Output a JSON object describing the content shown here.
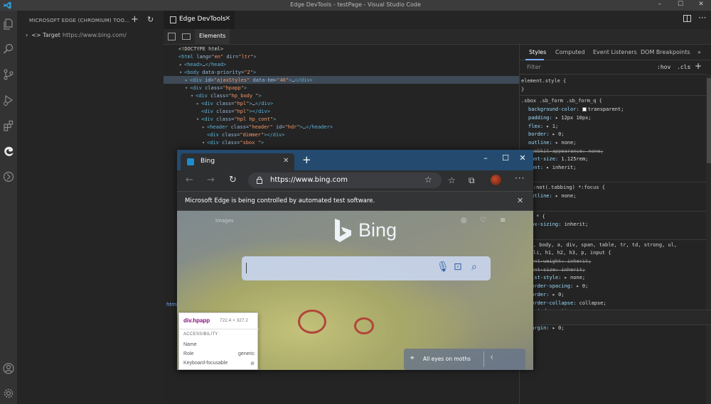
{
  "window": {
    "title": "Edge DevTools - testPage - Visual Studio Code"
  },
  "activity_bar": {
    "icons": [
      "explorer-icon",
      "search-icon",
      "source-control-icon",
      "run-debug-icon",
      "extensions-icon",
      "edge-devtools-icon",
      "remote-explorer-icon",
      "account-icon",
      "settings-gear-icon"
    ]
  },
  "sidebar": {
    "header": "MICROSOFT EDGE (CHROMIUM) TOO...",
    "target_label": "Target",
    "target_url": "https://www.bing.com/"
  },
  "editor": {
    "tab_label": "Edge DevTools"
  },
  "devtools": {
    "panel_tab": "Elements",
    "dom": [
      {
        "indent": 0,
        "tri": "",
        "parts": [
          [
            "txt",
            "<!DOCTYPE html>"
          ]
        ]
      },
      {
        "indent": 0,
        "tri": "",
        "parts": [
          [
            "tag",
            "<html "
          ],
          [
            "attr",
            "lang="
          ],
          [
            "val",
            "\"en\""
          ],
          [
            "attr",
            " dir="
          ],
          [
            "val",
            "\"ltr\""
          ],
          [
            "tag",
            ">"
          ]
        ]
      },
      {
        "indent": 1,
        "tri": "▸",
        "parts": [
          [
            "tag",
            "<head>"
          ],
          [
            "txt",
            "…"
          ],
          [
            "tag",
            "</head>"
          ]
        ]
      },
      {
        "indent": 1,
        "tri": "▾",
        "parts": [
          [
            "tag",
            "<body "
          ],
          [
            "attr",
            "data-priority="
          ],
          [
            "val",
            "\"2\""
          ],
          [
            "tag",
            ">"
          ]
        ]
      },
      {
        "indent": 2,
        "tri": "▸",
        "parts": [
          [
            "tag",
            "<div "
          ],
          [
            "attr",
            "id="
          ],
          [
            "val",
            "\"ajaxStyles\""
          ],
          [
            "attr",
            " data-bm="
          ],
          [
            "val",
            "\"40\""
          ],
          [
            "tag",
            ">"
          ],
          [
            "txt",
            "…"
          ],
          [
            "tag",
            "</div>"
          ]
        ]
      },
      {
        "indent": 2,
        "tri": "▾",
        "parts": [
          [
            "tag",
            "<div "
          ],
          [
            "attr",
            "class="
          ],
          [
            "val",
            "\"hpapp\""
          ],
          [
            "tag",
            ">"
          ]
        ]
      },
      {
        "indent": 3,
        "tri": "▾",
        "parts": [
          [
            "tag",
            "<div "
          ],
          [
            "attr",
            "class="
          ],
          [
            "val",
            "\"hp_body  \""
          ],
          [
            "tag",
            ">"
          ]
        ]
      },
      {
        "indent": 4,
        "tri": "▸",
        "parts": [
          [
            "tag",
            "<div "
          ],
          [
            "attr",
            "class="
          ],
          [
            "val",
            "\"hpl\""
          ],
          [
            "tag",
            ">"
          ],
          [
            "txt",
            "…"
          ],
          [
            "tag",
            "</div>"
          ]
        ]
      },
      {
        "indent": 4,
        "tri": "",
        "parts": [
          [
            "tag",
            "<div "
          ],
          [
            "attr",
            "class="
          ],
          [
            "val",
            "\"hpl\""
          ],
          [
            "tag",
            "></div>"
          ]
        ]
      },
      {
        "indent": 4,
        "tri": "▾",
        "parts": [
          [
            "tag",
            "<div "
          ],
          [
            "attr",
            "class="
          ],
          [
            "val",
            "\"hpl hp_cont\""
          ],
          [
            "tag",
            ">"
          ]
        ]
      },
      {
        "indent": 5,
        "tri": "▸",
        "parts": [
          [
            "tag",
            "<header "
          ],
          [
            "attr",
            "class="
          ],
          [
            "val",
            "\"header\""
          ],
          [
            "attr",
            " id="
          ],
          [
            "val",
            "\"hdr\""
          ],
          [
            "tag",
            ">"
          ],
          [
            "txt",
            "…"
          ],
          [
            "tag",
            "</header>"
          ]
        ]
      },
      {
        "indent": 5,
        "tri": "",
        "parts": [
          [
            "tag",
            "<div "
          ],
          [
            "attr",
            "class="
          ],
          [
            "val",
            "\"dimmer\""
          ],
          [
            "tag",
            "></div>"
          ]
        ]
      },
      {
        "indent": 5,
        "tri": "▾",
        "parts": [
          [
            "tag",
            "<div "
          ],
          [
            "attr",
            "class="
          ],
          [
            "val",
            "\"sbox \""
          ],
          [
            "tag",
            ">"
          ]
        ]
      }
    ],
    "styles_tabs": [
      "Styles",
      "Computed",
      "Event Listeners",
      "DOM Breakpoints",
      "»"
    ],
    "filter_placeholder": "Filter",
    "hov": ":hov",
    "cls": ".cls",
    "css": [
      {
        "t": "sel",
        "s": "element.style {"
      },
      {
        "t": "sel",
        "s": "}"
      },
      {
        "t": "div"
      },
      {
        "t": "sel",
        "s": ".sbox .sb_form .sb_form_q {"
      },
      {
        "t": "prop",
        "p": "background-color",
        "v": "transparent;",
        "swatch": "#ffffff"
      },
      {
        "t": "prop",
        "p": "padding",
        "v": "▸ 12px 10px;"
      },
      {
        "t": "prop",
        "p": "flex",
        "v": "▸ 1;"
      },
      {
        "t": "prop",
        "p": "border",
        "v": "▸ 0;"
      },
      {
        "t": "prop",
        "p": "outline",
        "v": "▸ none;"
      },
      {
        "t": "strike",
        "p": "-webkit-appearance",
        "v": "none;"
      },
      {
        "t": "prop",
        "p": "font-size",
        "v": "1.125rem;"
      },
      {
        "t": "prop",
        "p": "font",
        "v": "▸ inherit;"
      },
      {
        "t": "sel",
        "s": "}"
      },
      {
        "t": "div"
      },
      {
        "t": "sel",
        "s": "body:not(.tabbing) *:focus {"
      },
      {
        "t": "prop",
        "p": "outline",
        "v": "▸ none;"
      },
      {
        "t": "sel",
        "s": "}"
      },
      {
        "t": "div"
      },
      {
        "t": "sel",
        "s": "html * {"
      },
      {
        "t": "prop",
        "p": "box-sizing",
        "v": "inherit;"
      },
      {
        "t": "sel",
        "s": "}"
      },
      {
        "t": "div"
      },
      {
        "t": "sel",
        "s": "html, body, a, div, span, table, tr, td, strong, ul,"
      },
      {
        "t": "sel",
        "s": "ol, li, h1, h2, h3, p, input {"
      },
      {
        "t": "strike",
        "p": "font-weight",
        "v": "inherit;"
      },
      {
        "t": "strike",
        "p": "font-size",
        "v": "inherit;"
      },
      {
        "t": "prop",
        "p": "list-style",
        "v": "▸ none;"
      },
      {
        "t": "prop",
        "p": "border-spacing",
        "v": "▸ 0;"
      },
      {
        "t": "prop",
        "p": "border",
        "v": "▸ 0;"
      },
      {
        "t": "prop",
        "p": "border-collapse",
        "v": "collapse;"
      },
      {
        "t": "prop",
        "p": "text-decoration",
        "v": "▸ none;"
      },
      {
        "t": "strike",
        "p": "padding",
        "v": "▸ 0;"
      },
      {
        "t": "prop",
        "p": "margin",
        "v": "▸ 0;"
      }
    ],
    "drawer_stub": "html"
  },
  "browser": {
    "tab_label": "Bing",
    "url": "https://www.bing.com",
    "infobar": "Microsoft Edge is being controlled by automated test software.",
    "nav_images": "Images",
    "bing_word": "Bing",
    "caption": "All eyes on moths"
  },
  "inspect": {
    "selector": "div.hpapp",
    "dims": "722.4 × 327.2",
    "section": "ACCESSIBILITY",
    "rows": [
      {
        "k": "Name",
        "v": ""
      },
      {
        "k": "Role",
        "v": "generic"
      },
      {
        "k": "Keyboard-focusable",
        "v": "⊘"
      }
    ]
  }
}
